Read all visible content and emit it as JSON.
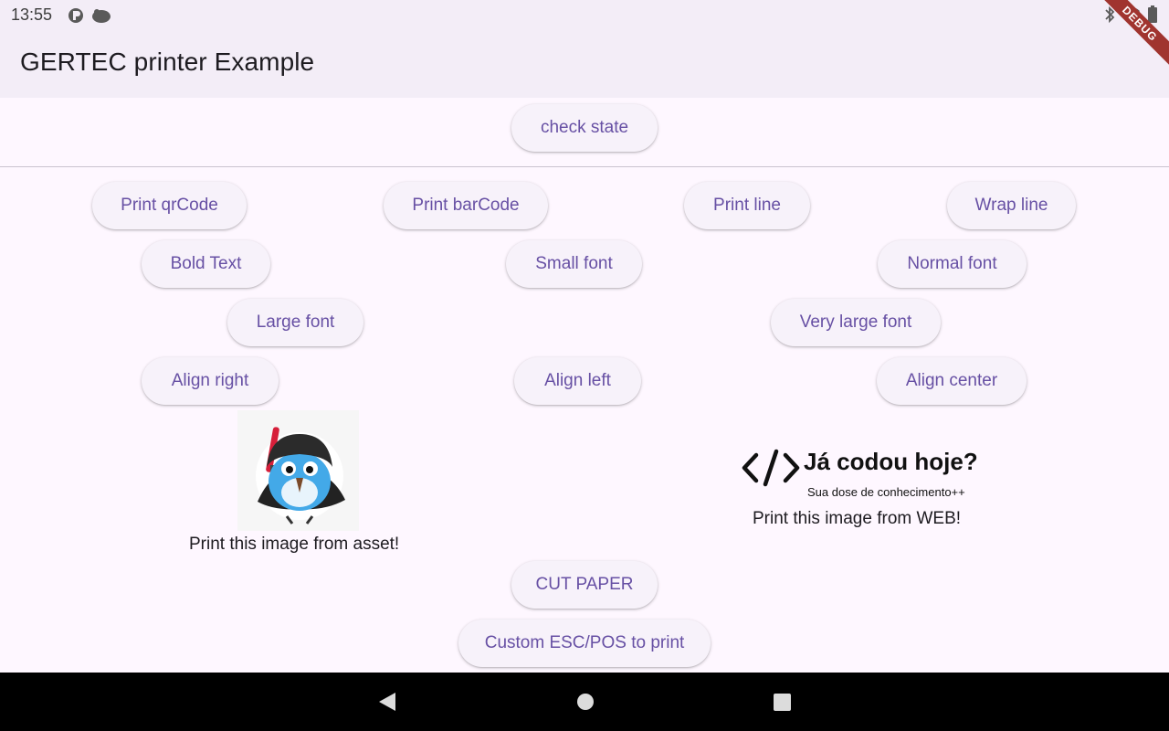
{
  "status_bar": {
    "time": "13:55"
  },
  "app_bar": {
    "title": "GERTEC printer Example"
  },
  "debug_banner": "DEBUG",
  "buttons": {
    "check_state": "check state",
    "print_qrcode": "Print qrCode",
    "print_barcode": "Print barCode",
    "print_line": "Print line",
    "wrap_line": "Wrap line",
    "bold_text": "Bold Text",
    "small_font": "Small font",
    "normal_font": "Normal font",
    "large_font": "Large font",
    "very_large_font": "Very large font",
    "align_right": "Align right",
    "align_left": "Align left",
    "align_center": "Align center",
    "cut_paper": "CUT PAPER",
    "custom_escpos": "Custom ESC/POS to print"
  },
  "images": {
    "asset_caption": "Print this image from asset!",
    "web_caption": "Print this image from WEB!",
    "web_logo_text": "Já codou hoje?",
    "web_logo_tagline": "Sua dose de conhecimento++"
  },
  "colors": {
    "accent": "#6750a4",
    "surface": "#fef7ff",
    "app_bar": "#f3edf7",
    "debug_ribbon": "#a0342f"
  }
}
